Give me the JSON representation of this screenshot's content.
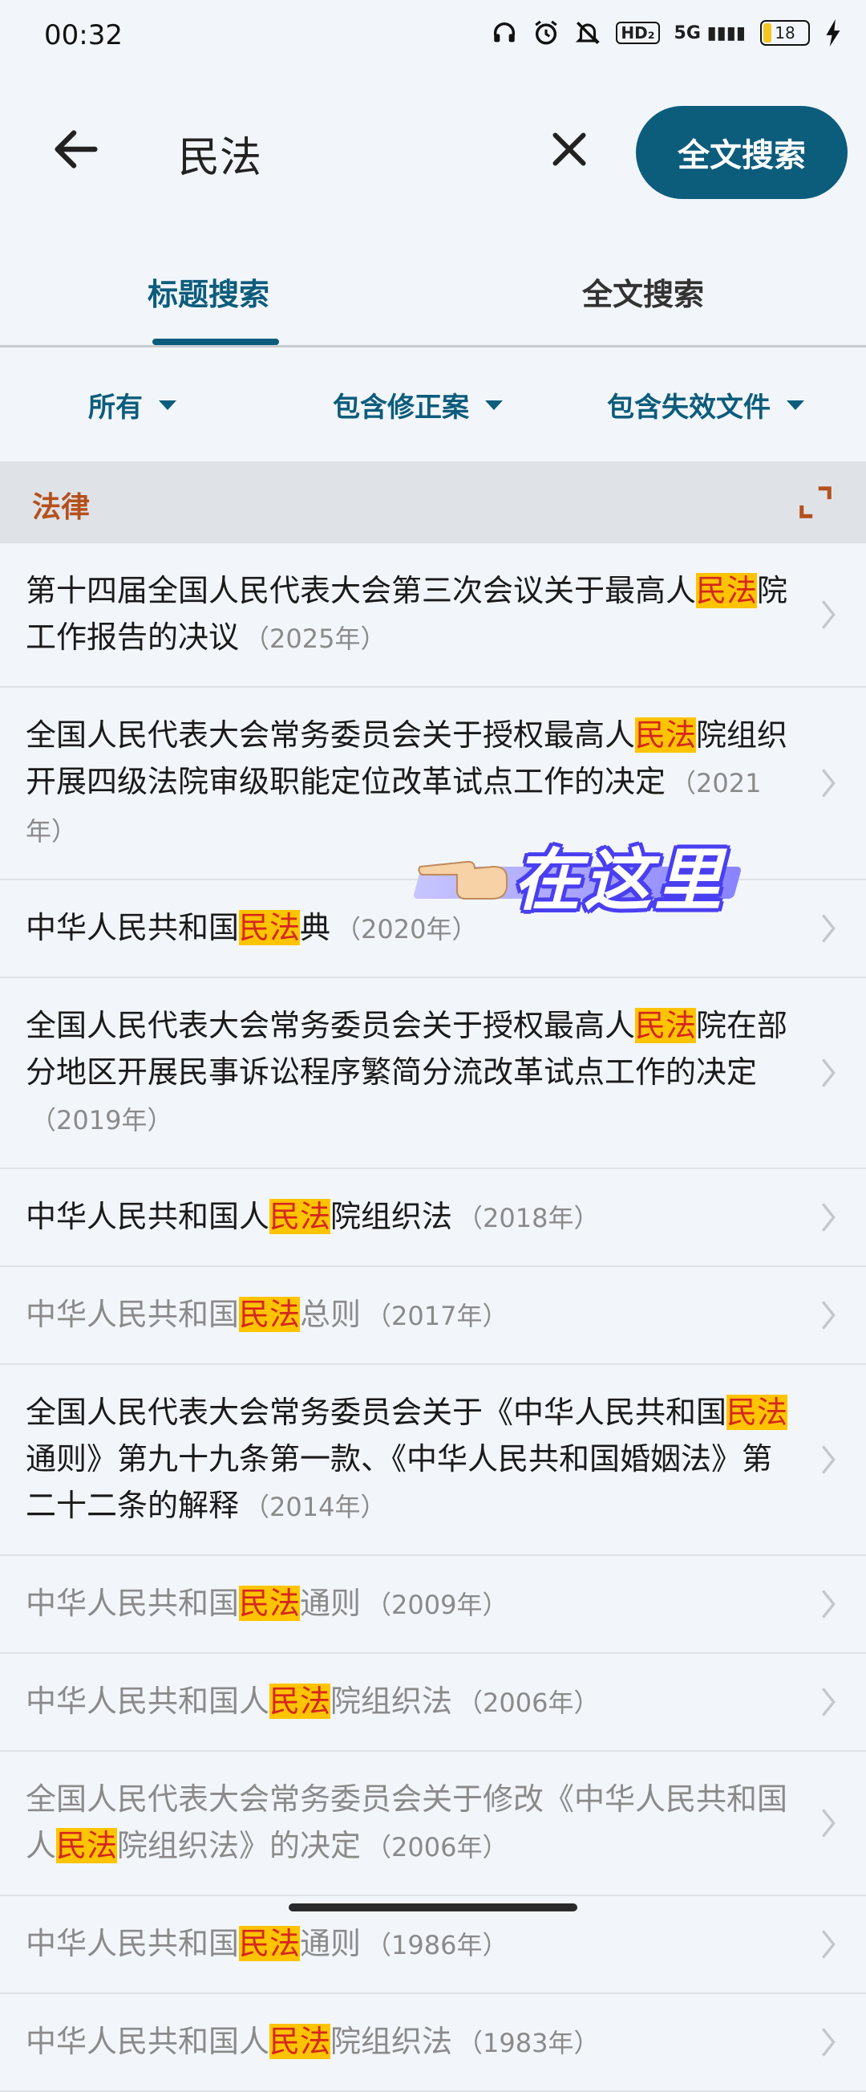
{
  "status_bar": {
    "time": "00:32",
    "network": "5G",
    "battery": "18"
  },
  "search": {
    "query": "民法",
    "fulltext_button": "全文搜索"
  },
  "tabs": [
    {
      "label": "标题搜索",
      "active": true
    },
    {
      "label": "全文搜索",
      "active": false
    }
  ],
  "filters": [
    "所有",
    "包含修正案",
    "包含失效文件"
  ],
  "section": {
    "title": "法律"
  },
  "highlight_term": "民法",
  "results": [
    {
      "parts": [
        "第十四届全国人民代表大会第三次会议关于最高人",
        "民法",
        "院工作报告的决议"
      ],
      "year": "（2025年）",
      "inactive": false
    },
    {
      "parts": [
        "全国人民代表大会常务委员会关于授权最高人",
        "民法",
        "院组织开展四级法院审级职能定位改革试点工作的决定"
      ],
      "year": "（2021年）",
      "inactive": false
    },
    {
      "parts": [
        "中华人民共和国",
        "民法",
        "典"
      ],
      "year": "（2020年）",
      "inactive": false
    },
    {
      "parts": [
        "全国人民代表大会常务委员会关于授权最高人",
        "民法",
        "院在部分地区开展民事诉讼程序繁简分流改革试点工作的决定"
      ],
      "year": "（2019年）",
      "inactive": false
    },
    {
      "parts": [
        "中华人民共和国人",
        "民法",
        "院组织法"
      ],
      "year": "（2018年）",
      "inactive": false
    },
    {
      "parts": [
        "中华人民共和国",
        "民法",
        "总则"
      ],
      "year": "（2017年）",
      "inactive": true
    },
    {
      "parts": [
        "全国人民代表大会常务委员会关于《中华人民共和国",
        "民法",
        "通则》第九十九条第一款、《中华人民共和国婚姻法》第二十二条的解释"
      ],
      "year": "（2014年）",
      "inactive": false
    },
    {
      "parts": [
        "中华人民共和国",
        "民法",
        "通则"
      ],
      "year": "（2009年）",
      "inactive": true
    },
    {
      "parts": [
        "中华人民共和国人",
        "民法",
        "院组织法"
      ],
      "year": "（2006年）",
      "inactive": true
    },
    {
      "parts": [
        "全国人民代表大会常务委员会关于修改《中华人民共和国人",
        "民法",
        "院组织法》的决定"
      ],
      "year": "（2006年）",
      "inactive": true
    },
    {
      "parts": [
        "中华人民共和国",
        "民法",
        "通则"
      ],
      "year": "（1986年）",
      "inactive": true
    },
    {
      "parts": [
        "中华人民共和国人",
        "民法",
        "院组织法"
      ],
      "year": "（1983年）",
      "inactive": true
    }
  ],
  "annotation": {
    "text": "在这里"
  },
  "colors": {
    "accent": "#0c5c7c",
    "highlight_bg": "#ffc400",
    "highlight_text": "#d4271d",
    "section_title": "#b5501c"
  }
}
